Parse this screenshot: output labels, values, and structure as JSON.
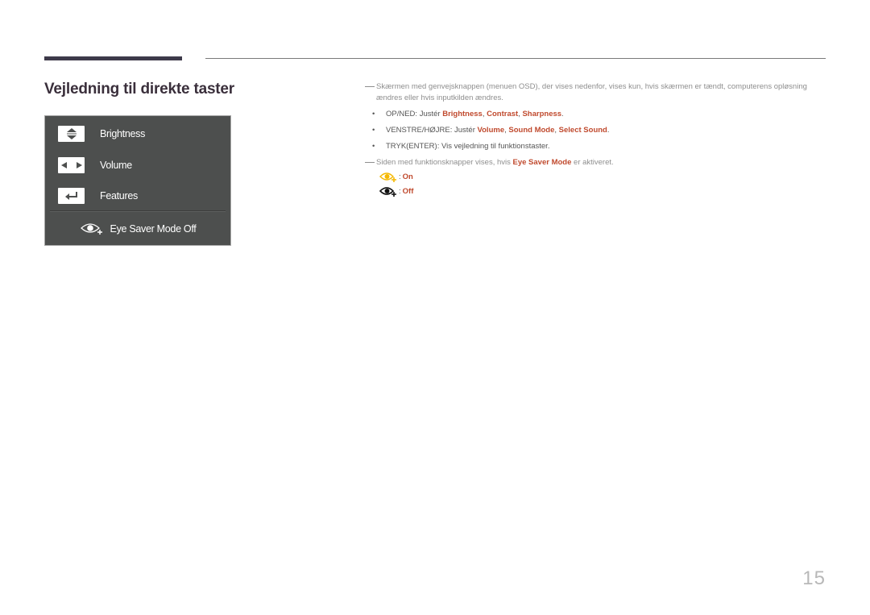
{
  "page": {
    "title": "Vejledning til direkte taster",
    "page_number": "15"
  },
  "osd": {
    "rows": [
      {
        "key_icon": "up-down-arrows-icon",
        "label": "Brightness"
      },
      {
        "key_icon": "left-right-arrows-icon",
        "label": "Volume"
      },
      {
        "key_icon": "enter-icon",
        "label": "Features"
      }
    ],
    "eye_saver": {
      "icon": "eye-saver-icon",
      "label": "Eye Saver Mode Off"
    }
  },
  "notes": {
    "para1": "Skærmen med genvejsknappen (menuen OSD), der vises nedenfor, vises kun, hvis skærmen er tændt, computerens opløsning ændres eller hvis inputkilden ændres.",
    "bullets": [
      {
        "prefix": "OP/NED: Justér ",
        "items": [
          "Brightness",
          "Contrast",
          "Sharpness"
        ],
        "suffix": "."
      },
      {
        "prefix": "VENSTRE/HØJRE: Justér ",
        "items": [
          "Volume",
          "Sound Mode",
          "Select Sound"
        ],
        "suffix": "."
      },
      {
        "prefix": "TRYK(ENTER): Vis vejledning til funktionstaster.",
        "items": [],
        "suffix": ""
      }
    ],
    "para2_prefix": "Siden med funktionsknapper vises, hvis ",
    "para2_highlight": "Eye Saver Mode",
    "para2_suffix": " er aktiveret.",
    "legend": [
      {
        "icon": "eye-saver-on-icon",
        "separator": ":",
        "value": "On",
        "color": "#f5b800"
      },
      {
        "icon": "eye-saver-off-icon",
        "separator": ":",
        "value": "Off",
        "color": "#111111"
      }
    ]
  },
  "colors": {
    "highlight": "#c04a2e",
    "panel_bg": "#4d4f4e",
    "title": "#3a2f3b"
  }
}
